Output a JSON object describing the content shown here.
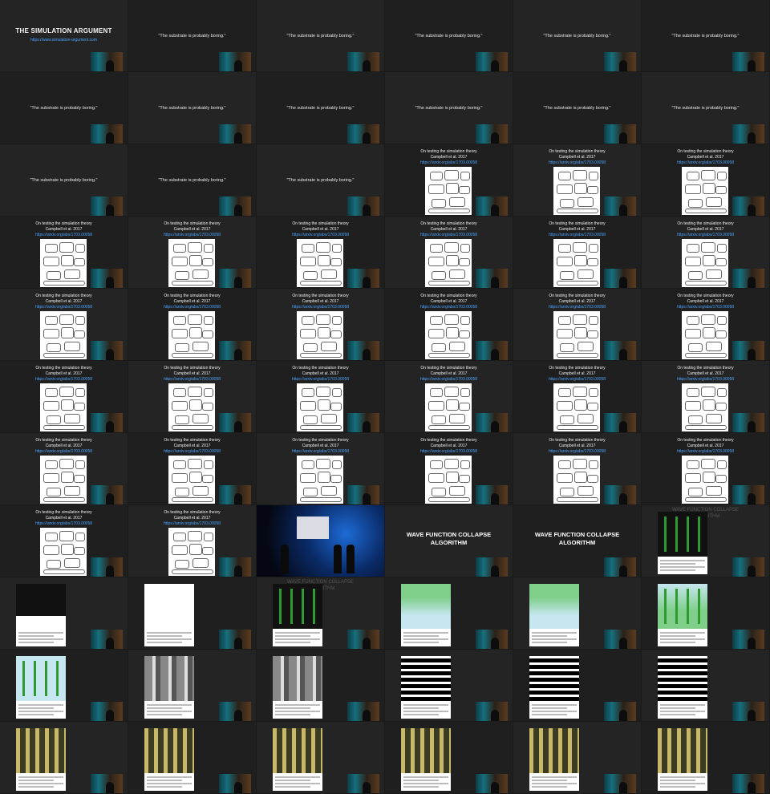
{
  "slides": {
    "title": "THE SIMULATION ARGUMENT",
    "title_link": "https://www.simulation-argument.com",
    "quote": "\"The substrate is probably boring.\"",
    "paper_title": "On testing the simulation theory",
    "paper_authors": "Campbell et al. 2017",
    "paper_link": "https://arxiv.org/abs/1703.00058",
    "wfc_line1": "WAVE FUNCTION COLLAPSE",
    "wfc_line2": "ALGORITHM",
    "ghost_line1": "WAVE FUNCTION COLLAPSE",
    "ghost_line2": "ALGORITHM"
  },
  "colors": {
    "background": "#1a1a1a",
    "frame": "#242424",
    "link": "#4aa3ff",
    "sky": "#c6e6f0",
    "plant_green": "#2f9a2f",
    "dune_green": "#7fcf8a",
    "bar_yellow": "#c8b868"
  },
  "icons": {
    "speaker_thumbnail": "speaker-video-icon",
    "paper_figure": "paper-diagram-icon",
    "tweet_card": "tweet-card-icon"
  }
}
